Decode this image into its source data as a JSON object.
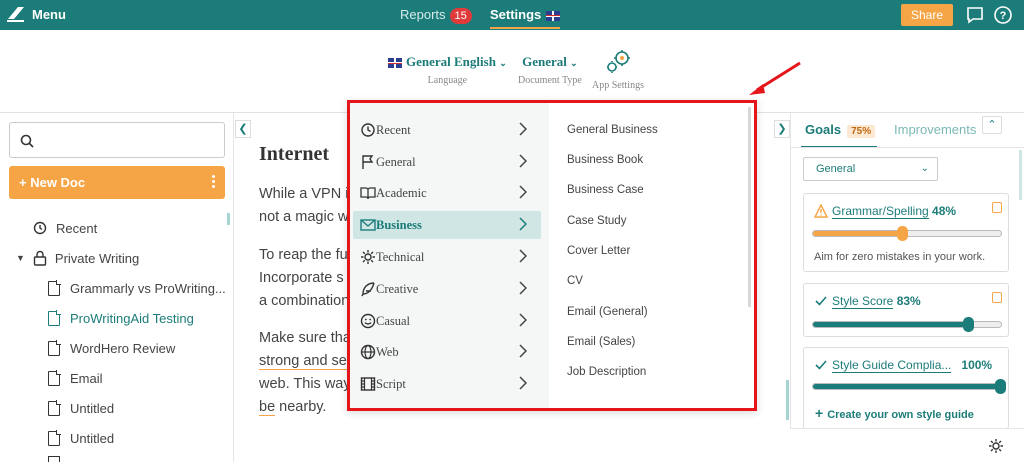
{
  "topbar": {
    "menu_label": "Menu",
    "tabs": [
      {
        "label": "Reports",
        "badge": "15"
      },
      {
        "label": "Settings"
      }
    ],
    "share_label": "Share"
  },
  "settings": {
    "language": {
      "value": "General English",
      "label": "Language"
    },
    "doc_type": {
      "value": "General",
      "label": "Document Type"
    },
    "app": {
      "label": "App Settings"
    }
  },
  "sidebar": {
    "new_doc": "+ New Doc",
    "items": [
      {
        "label": "Recent"
      },
      {
        "label": "Private Writing"
      },
      {
        "label": "Grammarly vs ProWriting..."
      },
      {
        "label": "ProWritingAid Testing"
      },
      {
        "label": "WordHero Review"
      },
      {
        "label": "Email"
      },
      {
        "label": "Untitled"
      },
      {
        "label": "Untitled"
      }
    ]
  },
  "editor": {
    "title": "Internet",
    "lines": [
      "While a VPN i",
      "not a magic w",
      "To reap the fu",
      "Incorporate s",
      "a combination",
      "Make sure tha",
      "strong and se",
      "web. This way",
      "be nearby."
    ]
  },
  "dropdown": {
    "categories": [
      {
        "label": "Recent",
        "icon": "history-icon"
      },
      {
        "label": "General",
        "icon": "flag-icon"
      },
      {
        "label": "Academic",
        "icon": "book-icon"
      },
      {
        "label": "Business",
        "icon": "envelope-icon"
      },
      {
        "label": "Technical",
        "icon": "gear-icon"
      },
      {
        "label": "Creative",
        "icon": "feather-icon"
      },
      {
        "label": "Casual",
        "icon": "smiley-icon"
      },
      {
        "label": "Web",
        "icon": "globe-icon"
      },
      {
        "label": "Script",
        "icon": "film-icon"
      }
    ],
    "selected": "Business",
    "doc_types": [
      "General Business",
      "Business Book",
      "Business Case",
      "Case Study",
      "Cover Letter",
      "CV",
      "Email (General)",
      "Email (Sales)",
      "Job Description"
    ]
  },
  "right_panel": {
    "tabs": {
      "goals": "Goals",
      "goals_pct": "75%",
      "improvements": "Improvements"
    },
    "select_value": "General",
    "cards": [
      {
        "title": "Grammar/Spelling",
        "pct": "48%",
        "note": "Aim for zero mistakes in your work.",
        "level": 0.48,
        "color": "#f5a545"
      },
      {
        "title": "Style Score",
        "pct": "83%",
        "level": 0.83,
        "color": "#1c7c79"
      },
      {
        "title": "Style Guide Complia...",
        "pct": "100%",
        "level": 1.0,
        "color": "#1c7c79"
      }
    ],
    "create_guide": "Create your own style guide"
  },
  "colors": {
    "brand": "#1c7c79",
    "accent": "#f5a545",
    "highlight": "#e5161b"
  }
}
